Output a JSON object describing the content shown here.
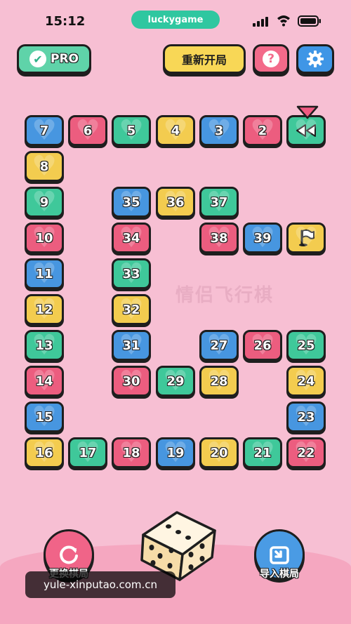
{
  "status_bar": {
    "time": "15:12",
    "app_pill": "luckygame"
  },
  "header": {
    "pro_label": "PRO",
    "restart_label": "重新开局",
    "help_label": "?"
  },
  "board": {
    "tiles": [
      {
        "n": "7",
        "color": "blue"
      },
      {
        "n": "6",
        "color": "red"
      },
      {
        "n": "5",
        "color": "green"
      },
      {
        "n": "4",
        "color": "yellow"
      },
      {
        "n": "3",
        "color": "blue"
      },
      {
        "n": "2",
        "color": "red"
      },
      {
        "n": "8",
        "color": "yellow"
      },
      {
        "n": "9",
        "color": "green"
      },
      {
        "n": "35",
        "color": "blue"
      },
      {
        "n": "36",
        "color": "yellow"
      },
      {
        "n": "37",
        "color": "green"
      },
      {
        "n": "10",
        "color": "red"
      },
      {
        "n": "34",
        "color": "red"
      },
      {
        "n": "38",
        "color": "red"
      },
      {
        "n": "39",
        "color": "blue"
      },
      {
        "n": "11",
        "color": "blue"
      },
      {
        "n": "33",
        "color": "green"
      },
      {
        "n": "12",
        "color": "yellow"
      },
      {
        "n": "32",
        "color": "yellow"
      },
      {
        "n": "13",
        "color": "green"
      },
      {
        "n": "31",
        "color": "blue"
      },
      {
        "n": "27",
        "color": "blue"
      },
      {
        "n": "26",
        "color": "red"
      },
      {
        "n": "25",
        "color": "green"
      },
      {
        "n": "14",
        "color": "red"
      },
      {
        "n": "30",
        "color": "red"
      },
      {
        "n": "29",
        "color": "green"
      },
      {
        "n": "28",
        "color": "yellow"
      },
      {
        "n": "24",
        "color": "yellow"
      },
      {
        "n": "15",
        "color": "blue"
      },
      {
        "n": "23",
        "color": "blue"
      },
      {
        "n": "16",
        "color": "yellow"
      },
      {
        "n": "17",
        "color": "green"
      },
      {
        "n": "18",
        "color": "red"
      },
      {
        "n": "19",
        "color": "blue"
      },
      {
        "n": "20",
        "color": "yellow"
      },
      {
        "n": "21",
        "color": "green"
      },
      {
        "n": "22",
        "color": "red"
      }
    ],
    "start_tile_icon": "rewind-start-icon",
    "finish_tile_icon": "finish-flag-icon",
    "watermark": "情侣飞行棋"
  },
  "footer": {
    "switch_label": "更换棋局",
    "import_label": "导入棋局",
    "dice_face": 5,
    "url_overlay": "yule-xinputao.com.cn"
  },
  "colors": {
    "blue": "#4796e0",
    "red": "#ec5d7f",
    "green": "#3fc89a",
    "yellow": "#f3cc4f",
    "background": "#f7bfd3"
  }
}
